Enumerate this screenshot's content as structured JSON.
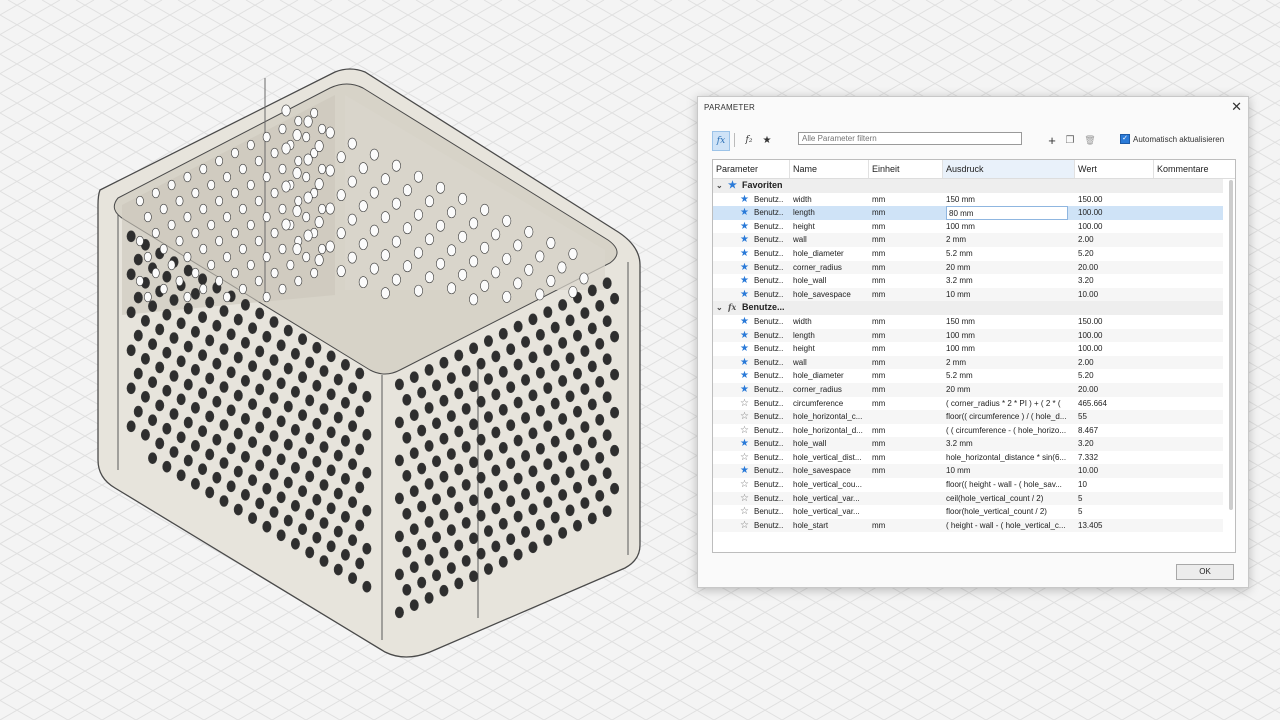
{
  "dialog": {
    "title": "PARAMETER",
    "close": "✕",
    "toolbar": {
      "fx_label": "fx",
      "fx2_label": "f₂",
      "star_label": "★",
      "filter_placeholder": "Alle Parameter filtern",
      "add": "+",
      "copy": "❐",
      "delete": "🗑",
      "auto_update_label": "Automatisch aktualisieren",
      "auto_update_check": "✓"
    },
    "columns": [
      "Parameter",
      "Name",
      "Einheit",
      "Ausdruck",
      "Wert",
      "Kommentare"
    ],
    "groups": [
      {
        "label": "Favoriten",
        "icon": "star",
        "chev": "⌄",
        "rows": [
          {
            "param": "Benutz..",
            "name": "width",
            "unit": "mm",
            "expr": "150 mm",
            "value": "150.00",
            "fav": true
          },
          {
            "param": "Benutz..",
            "name": "length",
            "unit": "mm",
            "expr": "80 mm",
            "value": "100.00",
            "fav": true,
            "selected": true
          },
          {
            "param": "Benutz..",
            "name": "height",
            "unit": "mm",
            "expr": "100 mm",
            "value": "100.00",
            "fav": true
          },
          {
            "param": "Benutz..",
            "name": "wall",
            "unit": "mm",
            "expr": "2 mm",
            "value": "2.00",
            "fav": true
          },
          {
            "param": "Benutz..",
            "name": "hole_diameter",
            "unit": "mm",
            "expr": "5.2 mm",
            "value": "5.20",
            "fav": true
          },
          {
            "param": "Benutz..",
            "name": "corner_radius",
            "unit": "mm",
            "expr": "20 mm",
            "value": "20.00",
            "fav": true
          },
          {
            "param": "Benutz..",
            "name": "hole_wall",
            "unit": "mm",
            "expr": "3.2 mm",
            "value": "3.20",
            "fav": true
          },
          {
            "param": "Benutz..",
            "name": "hole_savespace",
            "unit": "mm",
            "expr": "10 mm",
            "value": "10.00",
            "fav": true
          }
        ]
      },
      {
        "label": "Benutze...",
        "icon": "fx",
        "chev": "⌄",
        "rows": [
          {
            "param": "Benutz..",
            "name": "width",
            "unit": "mm",
            "expr": "150 mm",
            "value": "150.00",
            "fav": true
          },
          {
            "param": "Benutz..",
            "name": "length",
            "unit": "mm",
            "expr": "100 mm",
            "value": "100.00",
            "fav": true
          },
          {
            "param": "Benutz..",
            "name": "height",
            "unit": "mm",
            "expr": "100 mm",
            "value": "100.00",
            "fav": true
          },
          {
            "param": "Benutz..",
            "name": "wall",
            "unit": "mm",
            "expr": "2 mm",
            "value": "2.00",
            "fav": true
          },
          {
            "param": "Benutz..",
            "name": "hole_diameter",
            "unit": "mm",
            "expr": "5.2 mm",
            "value": "5.20",
            "fav": true
          },
          {
            "param": "Benutz..",
            "name": "corner_radius",
            "unit": "mm",
            "expr": "20 mm",
            "value": "20.00",
            "fav": true
          },
          {
            "param": "Benutz..",
            "name": "circumference",
            "unit": "mm",
            "expr": "( corner_radius * 2 * PI ) + ( 2 * (",
            "value": "465.664",
            "fav": false
          },
          {
            "param": "Benutz..",
            "name": "hole_horizontal_c...",
            "unit": "",
            "expr": "floor(( circumference ) / ( hole_d...",
            "value": "55",
            "fav": false
          },
          {
            "param": "Benutz..",
            "name": "hole_horizontal_d...",
            "unit": "mm",
            "expr": "( ( circumference - ( hole_horizo...",
            "value": "8.467",
            "fav": false
          },
          {
            "param": "Benutz..",
            "name": "hole_wall",
            "unit": "mm",
            "expr": "3.2 mm",
            "value": "3.20",
            "fav": true
          },
          {
            "param": "Benutz..",
            "name": "hole_vertical_dist...",
            "unit": "mm",
            "expr": "hole_horizontal_distance * sin(6...",
            "value": "7.332",
            "fav": false
          },
          {
            "param": "Benutz..",
            "name": "hole_savespace",
            "unit": "mm",
            "expr": "10 mm",
            "value": "10.00",
            "fav": true
          },
          {
            "param": "Benutz..",
            "name": "hole_vertical_cou...",
            "unit": "",
            "expr": "floor(( height - wall - ( hole_sav...",
            "value": "10",
            "fav": false
          },
          {
            "param": "Benutz..",
            "name": "hole_vertical_var...",
            "unit": "",
            "expr": "ceil(hole_vertical_count / 2)",
            "value": "5",
            "fav": false
          },
          {
            "param": "Benutz..",
            "name": "hole_vertical_var...",
            "unit": "",
            "expr": "floor(hole_vertical_count / 2)",
            "value": "5",
            "fav": false
          },
          {
            "param": "Benutz..",
            "name": "hole_start",
            "unit": "mm",
            "expr": "( height - wall - ( hole_vertical_c...",
            "value": "13.405",
            "fav": false
          }
        ]
      }
    ],
    "ok_label": "OK"
  },
  "colors": {
    "accent": "#2a7ad8",
    "model_fill": "#e7e4dc",
    "model_edge": "#4a4a4a",
    "grid": "#e0e0e0"
  }
}
